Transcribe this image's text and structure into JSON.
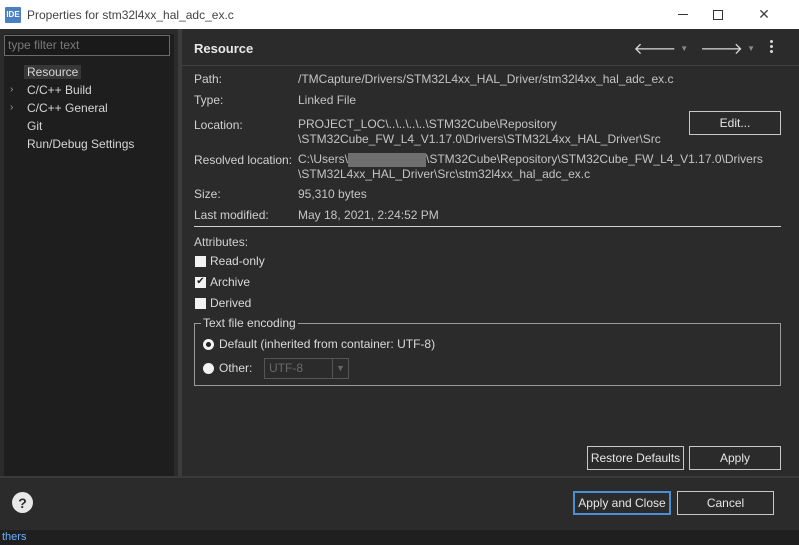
{
  "window": {
    "logo_text": "IDE",
    "title": "Properties for stm32l4xx_hal_adc_ex.c",
    "close_glyph": "✕"
  },
  "left": {
    "filter_placeholder": "type filter text",
    "tree": [
      {
        "label": "Resource",
        "expandable": false,
        "selected": true
      },
      {
        "label": "C/C++ Build",
        "expandable": true,
        "selected": false
      },
      {
        "label": "C/C++ General",
        "expandable": true,
        "selected": false
      },
      {
        "label": "Git",
        "expandable": false,
        "selected": false
      },
      {
        "label": "Run/Debug Settings",
        "expandable": false,
        "selected": false
      }
    ]
  },
  "right": {
    "title": "Resource",
    "path_label": "Path:",
    "path_value": "/TMCapture/Drivers/STM32L4xx_HAL_Driver/stm32l4xx_hal_adc_ex.c",
    "type_label": "Type:",
    "type_value": "Linked File",
    "location_label": "Location:",
    "location_line1": "PROJECT_LOC\\..\\..\\..\\..\\STM32Cube\\Repository",
    "location_line2": "\\STM32Cube_FW_L4_V1.17.0\\Drivers\\STM32L4xx_HAL_Driver\\Src",
    "edit_label": "Edit...",
    "resolved_label": "Resolved location:",
    "resolved_prefix": "C:\\Users\\",
    "resolved_suffix": "\\STM32Cube\\Repository\\STM32Cube_FW_L4_V1.17.0\\Drivers",
    "resolved_line2": "\\STM32L4xx_HAL_Driver\\Src\\stm32l4xx_hal_adc_ex.c",
    "size_label": "Size:",
    "size_value": "95,310  bytes",
    "modified_label": "Last modified:",
    "modified_value": "May 18, 2021, 2:24:52 PM",
    "attributes_label": "Attributes:",
    "attributes": [
      {
        "label": "Read-only",
        "checked": false
      },
      {
        "label": "Archive",
        "checked": true
      },
      {
        "label": "Derived",
        "checked": false
      }
    ],
    "encoding_legend": "Text file encoding",
    "default_option": "Default (inherited from container: UTF-8)",
    "other_option": "Other:",
    "other_value": "UTF-8",
    "restore_label": "Restore Defaults",
    "apply_label": "Apply"
  },
  "bottom": {
    "help_glyph": "?",
    "apply_close_label": "Apply and Close",
    "cancel_label": "Cancel",
    "behind_text": "thers"
  }
}
